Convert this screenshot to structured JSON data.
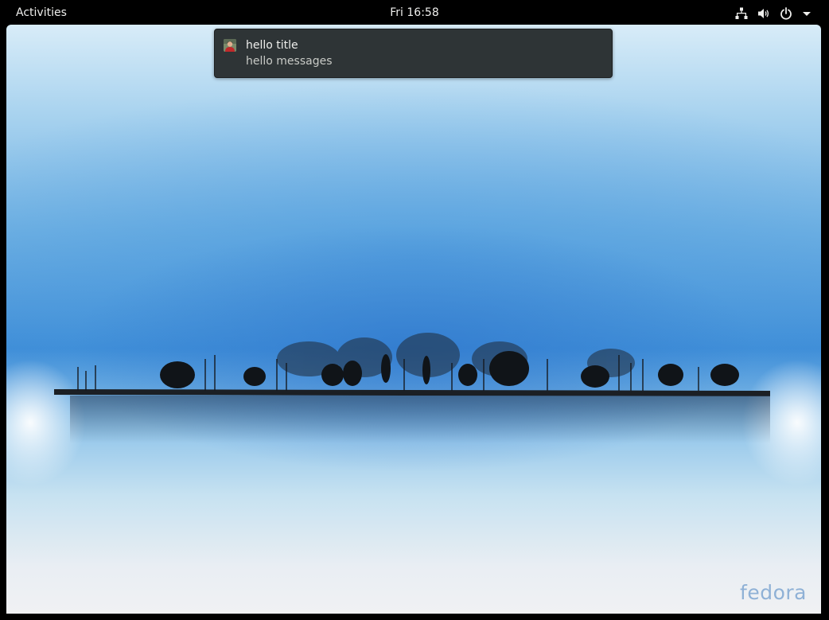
{
  "topbar": {
    "activities_label": "Activities",
    "clock_text": "Fri 16:58",
    "tray_icons": [
      "network-icon",
      "volume-icon",
      "power-icon",
      "chevron-down-icon"
    ]
  },
  "notification": {
    "title": "hello title",
    "message": "hello messages",
    "avatar_icon": "user-avatar-icon"
  },
  "desktop": {
    "wallpaper": "fedora-lake-treeline",
    "brand_text": "fedora"
  },
  "colors": {
    "topbar_bg": "#000000",
    "topbar_text": "#eeeeec",
    "notification_bg": "#2e3436",
    "brand": "#8fb1d6"
  }
}
